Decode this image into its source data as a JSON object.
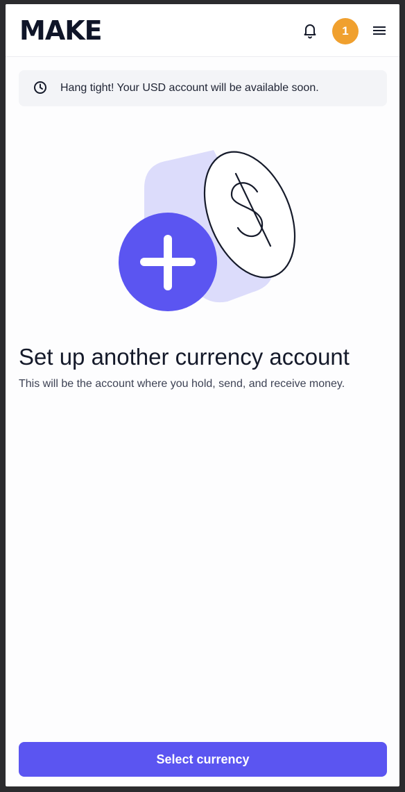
{
  "header": {
    "logo_text": "MAKE",
    "notification_count": "1",
    "icons": {
      "bell": "bell-icon",
      "menu": "hamburger-menu-icon"
    }
  },
  "banner": {
    "icon": "clock-icon",
    "message": "Hang tight! Your USD account will be available soon."
  },
  "main": {
    "illustration": "add-currency-illustration",
    "title": "Set up another currency account",
    "subtitle": "This will be the account where you hold, send, and receive money."
  },
  "footer": {
    "select_button_label": "Select currency"
  },
  "colors": {
    "accent": "#5b55f1",
    "badge": "#f0a02e",
    "illustration_shadow": "#dcdcfb",
    "banner_bg": "#f3f4f7"
  }
}
